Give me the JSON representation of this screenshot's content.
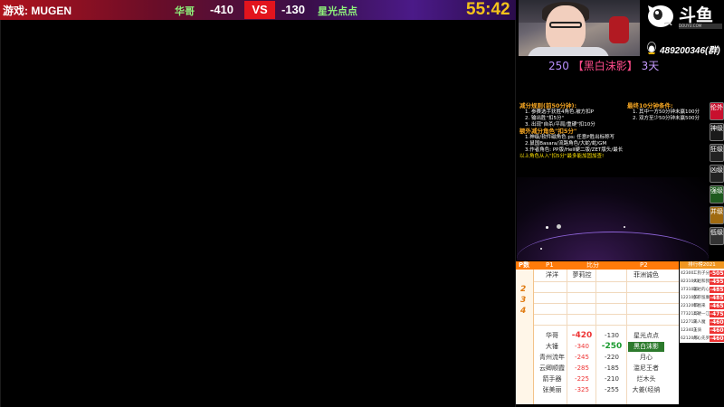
{
  "topbar": {
    "game_label": "游戏: MUGEN",
    "p1_name": "华哥",
    "p1_score": "-410",
    "vs": "VS",
    "p2_score": "-130",
    "p2_name": "星光点点",
    "timer": "55:42"
  },
  "branding": {
    "logo_text": "斗鱼",
    "logo_url": "DOUYU.COM",
    "qq_group": "489200346(群)"
  },
  "fan": {
    "count": "250",
    "badge": "【黑白沫影】",
    "days": "3天"
  },
  "rules": {
    "left_title": "减分规则(前50分钟):",
    "left_lines": [
      "1. 参赛选手获胜4角色,被方扣P",
      "2. 输出胜\"扣5分\"",
      "3. 出现\"自杀/平局/重硬\"扣10分"
    ],
    "extra_title": "额外减分角色\"扣5分\"",
    "extra_lines": [
      "1.神级/软件磁角色  ps: 任意P胜出标称写",
      "2.鼠国Basara/流路角色/大蛇/蛇/GM",
      "3.作者角色: PP版/Hell硬二版/ZET版头/最长"
    ],
    "warn_line": "以上角色从入\"扣5分\"最多能加固加查!",
    "right_title": "最终10分钟条件:",
    "right_lines": [
      "1. 其中一方50分钟未赢100分",
      "2. 双方至少50分钟未赢500分"
    ]
  },
  "tags": [
    {
      "label": "伦外",
      "color": "#c8102e"
    },
    {
      "label": "神级",
      "color": "#1a1a1a"
    },
    {
      "label": "狂级",
      "color": "#222"
    },
    {
      "label": "凶级",
      "color": "#222"
    },
    {
      "label": "强级",
      "color": "#1e5a1e"
    },
    {
      "label": "并级",
      "color": "#a06a10"
    },
    {
      "label": "低级",
      "color": "#333"
    }
  ],
  "score_table": {
    "headers": {
      "row": "P数",
      "p1": "P1",
      "ratio": "比分",
      "p2": "P2"
    },
    "first_row": {
      "p1": "洋洋",
      "p1b": "夢莉控",
      "p2": "菲洲诚色"
    },
    "row_numbers": [
      "2",
      "3",
      "4"
    ],
    "rows": [
      {
        "p1": "华哥",
        "s1": "-420",
        "s2": "-130",
        "p2": "星光点点"
      },
      {
        "p1": "大锤",
        "s1": "-340",
        "s2": "-250",
        "p2": "黑白沫影"
      },
      {
        "p1": "青州流年",
        "s1": "-245",
        "s2": "-220",
        "p2": "月心"
      },
      {
        "p1": "云卿顺霞",
        "s1": "-285",
        "s2": "-185",
        "p2": "滥尼王者"
      },
      {
        "p1": "箭手器",
        "s1": "-225",
        "s2": "-210",
        "p2": "烂木头"
      },
      {
        "p1": "张美丽",
        "s1": "-325",
        "s2": "-255",
        "p2": "大姜(经纳"
      }
    ]
  },
  "rank": {
    "title": "排行榜2021",
    "rows": [
      {
        "id": "423001",
        "name": "二狗子分",
        "score": "-505"
      },
      {
        "id": "8231003",
        "name": "大姐和我",
        "score": "-495"
      },
      {
        "id": "3731033",
        "name": "聪达的心",
        "score": "-485"
      },
      {
        "id": "1221003",
        "name": "彭宗留廉",
        "score": "-485"
      },
      {
        "id": "2212003",
        "name": "菲图来",
        "score": "-465"
      },
      {
        "id": "7732113",
        "name": "高硬一江",
        "score": "-475"
      },
      {
        "id": "122713",
        "name": "隔人魔",
        "score": "-460"
      },
      {
        "id": "123403",
        "name": "玉骑",
        "score": "-460"
      },
      {
        "id": "6212003",
        "name": "月心先罗",
        "score": "-460"
      }
    ]
  }
}
